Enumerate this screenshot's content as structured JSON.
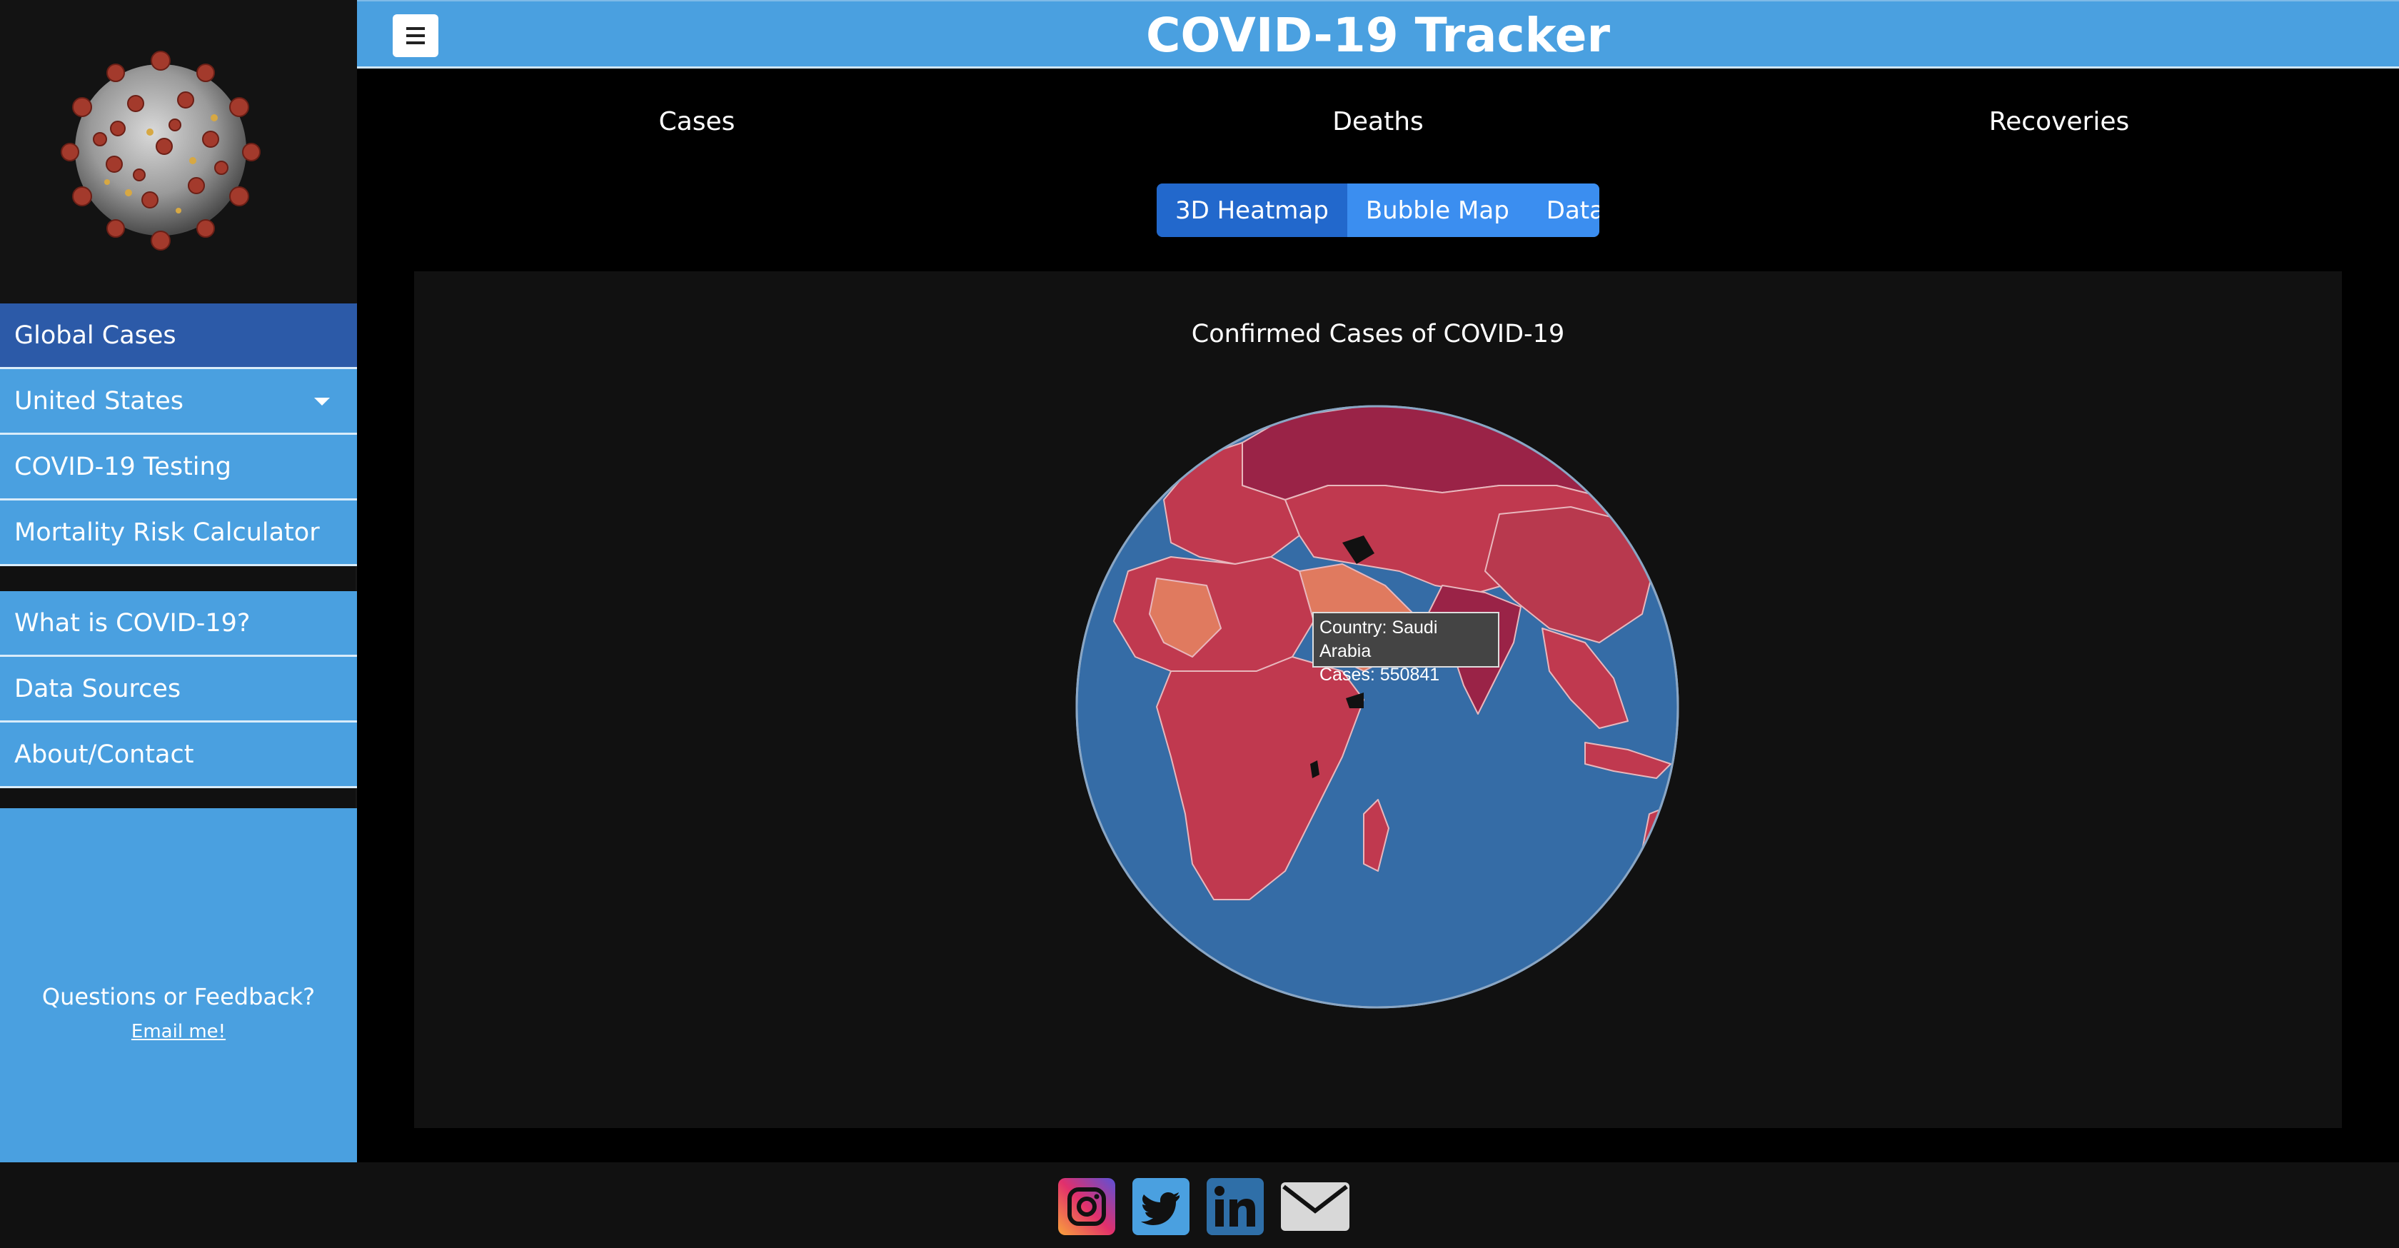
{
  "app": {
    "title": "COVID-19 Tracker"
  },
  "header": {
    "menu_icon": "hamburger-icon"
  },
  "sidebar": {
    "logo_icon": "coronavirus-logo",
    "items": [
      {
        "label": "Global Cases",
        "active": true
      },
      {
        "label": "United States",
        "dropdown": true
      },
      {
        "label": "COVID-19 Testing"
      },
      {
        "label": "Mortality Risk Calculator"
      },
      {
        "label": "What is COVID-19?"
      },
      {
        "label": "Data Sources"
      },
      {
        "label": "About/Contact"
      }
    ],
    "feedback": {
      "question": "Questions or Feedback?",
      "link": "Email me!"
    }
  },
  "metric_tabs": [
    "Cases",
    "Deaths",
    "Recoveries"
  ],
  "view_tabs": [
    {
      "label": "3D Heatmap",
      "active": true
    },
    {
      "label": "Bubble Map"
    },
    {
      "label": "Data"
    }
  ],
  "chart": {
    "title": "Confirmed Cases of COVID-19",
    "tooltip": {
      "country_line": "Country: Saudi Arabia",
      "cases_line": "Cases: 550841"
    }
  },
  "colors": {
    "accent": "#4aa0e0",
    "active_nav": "#2c5aa8",
    "ocean": "#356ca6",
    "land_high": "#9a2347",
    "land_mid": "#c0394f",
    "land_low": "#e07a5f"
  },
  "footer": {
    "icons": [
      "instagram-icon",
      "twitter-icon",
      "linkedin-icon",
      "email-icon"
    ]
  }
}
